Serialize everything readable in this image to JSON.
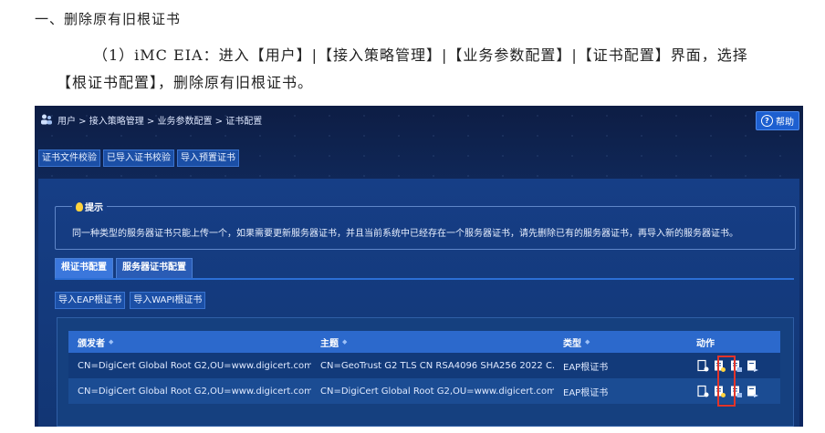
{
  "document": {
    "heading": "一、删除原有旧根证书",
    "paragraph": "（1）iMC EIA：进入【用户】|【接入策略管理】|【业务参数配置】|【证书配置】界面，选择【根证书配置】，删除原有旧根证书。"
  },
  "screenshot": {
    "breadcrumb": "用户 > 接入策略管理 > 业务参数配置 > 证书配置",
    "help_label": "帮助",
    "top_actions": [
      "证书文件校验",
      "已导入证书校验",
      "导入预置证书"
    ],
    "tip": {
      "title": "提示",
      "text": "同一种类型的服务器证书只能上传一个，如果需要更新服务器证书，并且当前系统中已经存在一个服务器证书，请先删除已有的服务器证书，再导入新的服务器证书。"
    },
    "tabs": [
      {
        "label": "根证书配置",
        "active": true
      },
      {
        "label": "服务器证书配置",
        "active": false
      }
    ],
    "sub_actions": [
      "导入EAP根证书",
      "导入WAPI根证书"
    ],
    "table": {
      "columns": [
        "颁发者",
        "主题",
        "类型",
        "动作"
      ],
      "rows": [
        {
          "issuer": "CN=DigiCert Global Root G2,OU=www.digicert.com,...",
          "subject": "CN=GeoTrust G2 TLS CN RSA4096 SHA256 2022 C...",
          "type": "EAP根证书",
          "actions": [
            "view-cert-icon",
            "download-cert-icon",
            "delete-cert-icon",
            "export-cert-icon"
          ]
        },
        {
          "issuer": "CN=DigiCert Global Root G2,OU=www.digicert.com,...",
          "subject": "CN=DigiCert Global Root G2,OU=www.digicert.com,...",
          "type": "EAP根证书",
          "actions": [
            "view-cert-icon",
            "download-cert-icon",
            "delete-cert-icon",
            "export-cert-icon"
          ]
        }
      ]
    },
    "colors": {
      "panel_bg": "#0d1d44",
      "header_blue": "#2c69cc",
      "highlight_red": "#e2342a"
    }
  }
}
